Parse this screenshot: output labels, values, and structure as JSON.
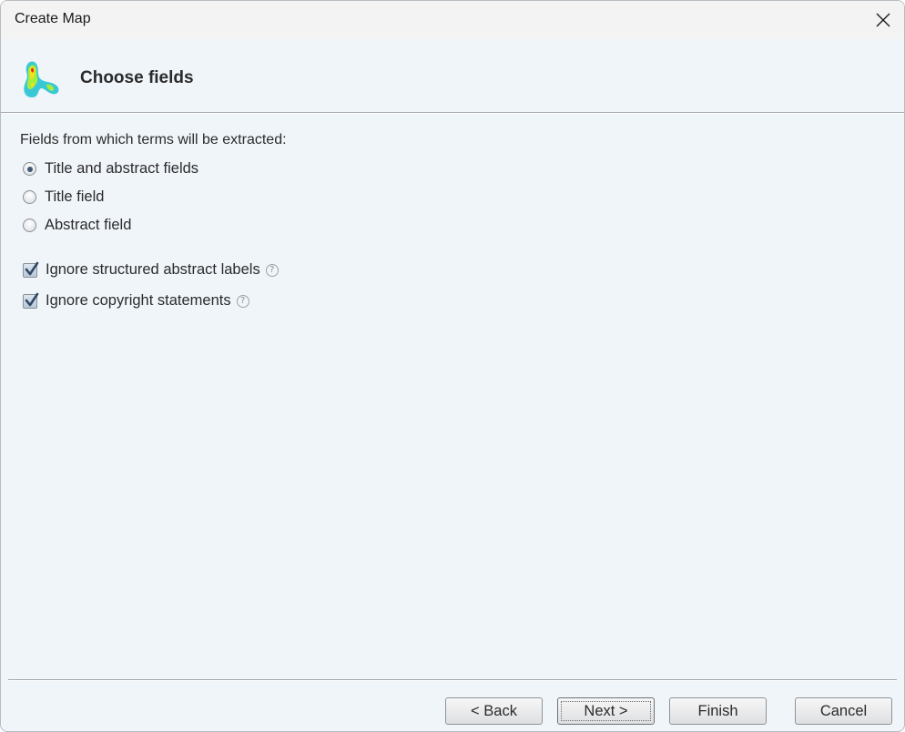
{
  "window": {
    "title": "Create Map",
    "close_icon": "close-icon"
  },
  "header": {
    "title": "Choose fields",
    "icon": "map-density-icon"
  },
  "fields": {
    "label": "Fields from which terms will be extracted:",
    "options": [
      {
        "label": "Title and abstract fields",
        "selected": true
      },
      {
        "label": "Title field",
        "selected": false
      },
      {
        "label": "Abstract field",
        "selected": false
      }
    ]
  },
  "checkboxes": [
    {
      "label": "Ignore structured abstract labels",
      "checked": true,
      "help": "?"
    },
    {
      "label": "Ignore copyright statements",
      "checked": true,
      "help": "?"
    }
  ],
  "buttons": {
    "back": "< Back",
    "next": "Next >",
    "finish": "Finish",
    "cancel": "Cancel"
  }
}
